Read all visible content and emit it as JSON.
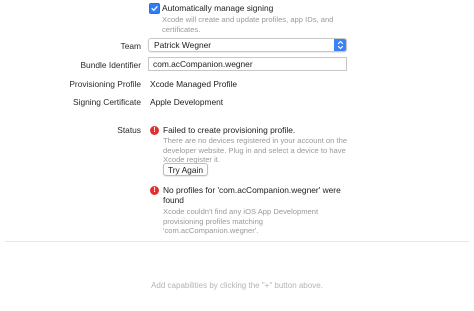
{
  "signing": {
    "auto_manage_label": "Automatically manage signing",
    "auto_manage_checked": true,
    "auto_manage_desc": "Xcode will create and update profiles, app IDs, and certificates."
  },
  "fields": {
    "team_label": "Team",
    "team_value": "Patrick Wegner",
    "bundle_label": "Bundle Identifier",
    "bundle_value": "com.acCompanion.wegner",
    "profile_label": "Provisioning Profile",
    "profile_value": "Xcode Managed Profile",
    "cert_label": "Signing Certificate",
    "cert_value": "Apple Development"
  },
  "status": {
    "label": "Status",
    "error1_title": "Failed to create provisioning profile.",
    "error1_desc": "There are no devices registered in your account on the developer website. Plug in and select a device to have Xcode register it.",
    "try_again_label": "Try Again",
    "error2_title": "No profiles for 'com.acCompanion.wegner' were found",
    "error2_desc": "Xcode couldn't find any iOS App Development provisioning profiles matching 'com.acCompanion.wegner'."
  },
  "footer": {
    "hint": "Add capabilities by clicking the \"+\" button above."
  },
  "colors": {
    "accent": "#2f7ef6",
    "error": "#e03131"
  },
  "icons": {
    "checkbox": "checkmark-icon",
    "popup": "chevron-updown-icon",
    "error": "exclamation-circle-icon"
  }
}
